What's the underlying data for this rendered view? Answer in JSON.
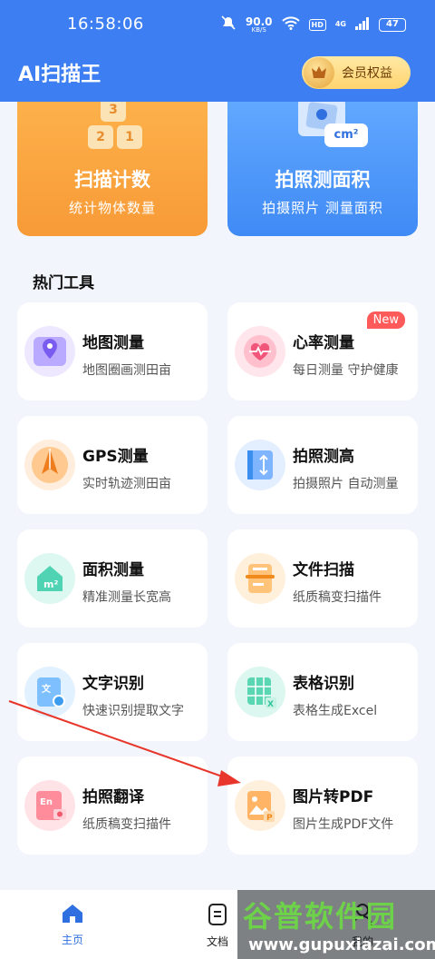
{
  "status": {
    "time": "16:58:06",
    "speed_value": "90.0",
    "speed_unit": "KB/S",
    "hd": "HD",
    "network": "4G",
    "battery": "47"
  },
  "header": {
    "title": "AI扫描王",
    "vip_label": "会员权益"
  },
  "features": [
    {
      "title": "扫描计数",
      "subtitle": "统计物体数量",
      "digits": [
        "3",
        "2",
        "1"
      ]
    },
    {
      "title": "拍照测面积",
      "subtitle": "拍摄照片 测量面积",
      "unit": "cm²"
    }
  ],
  "section_title": "热门工具",
  "tools": [
    {
      "title": "地图测量",
      "subtitle": "地图圈画测田亩",
      "icon": "map-pin-icon",
      "color": "#8e7bf0",
      "bg": "#ede8ff"
    },
    {
      "title": "心率测量",
      "subtitle": "每日测量 守护健康",
      "icon": "heart-rate-icon",
      "color": "#f2557a",
      "bg": "#ffe6ec",
      "badge": "New"
    },
    {
      "title": "GPS测量",
      "subtitle": "实时轨迹测田亩",
      "icon": "gps-compass-icon",
      "color": "#f39232",
      "bg": "#ffeedd"
    },
    {
      "title": "拍照测高",
      "subtitle": "拍摄照片 自动测量",
      "icon": "height-ruler-icon",
      "color": "#3b8df0",
      "bg": "#e3efff"
    },
    {
      "title": "面积测量",
      "subtitle": "精准测量长宽高",
      "icon": "area-house-icon",
      "color": "#33c7a6",
      "bg": "#ddf8f1"
    },
    {
      "title": "文件扫描",
      "subtitle": "纸质稿变扫描件",
      "icon": "document-scan-icon",
      "color": "#f5a23c",
      "bg": "#fff0dc"
    },
    {
      "title": "文字识别",
      "subtitle": "快速识别提取文字",
      "icon": "text-recognition-icon",
      "color": "#3b9cf0",
      "bg": "#e2f1ff"
    },
    {
      "title": "表格识别",
      "subtitle": "表格生成Excel",
      "icon": "table-recognition-icon",
      "color": "#2fc49c",
      "bg": "#dcf7ef"
    },
    {
      "title": "拍照翻译",
      "subtitle": "纸质稿变扫描件",
      "icon": "photo-translate-icon",
      "color": "#f25a6b",
      "bg": "#ffe3e7"
    },
    {
      "title": "图片转PDF",
      "subtitle": "图片生成PDF文件",
      "icon": "image-to-pdf-icon",
      "color": "#f59a3a",
      "bg": "#fff0dd"
    }
  ],
  "nav": {
    "home": "主页",
    "docs": "文档",
    "mine": "我的"
  },
  "watermark": {
    "main": "谷普软件园",
    "url": "www.gupuxiazai.com"
  },
  "colors": {
    "primary": "#3d7ff2",
    "active_nav": "#2f6fe0"
  }
}
